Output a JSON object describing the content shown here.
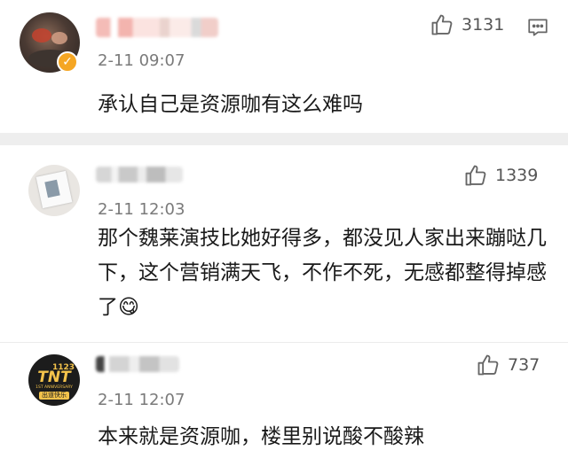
{
  "comments": [
    {
      "time": "2-11 09:07",
      "text": "承认自己是资源咖有这么难吗",
      "likes": "3131",
      "verified": true
    },
    {
      "time": "2-11 12:03",
      "text": "那个魏莱演技比她好得多，都没见人家出来蹦哒几下，这个营销满天飞，不作不死，无感都整得掉感了😋",
      "likes": "1339"
    },
    {
      "time": "2-11 12:07",
      "text": "本来就是资源咖，楼里别说酸不酸辣",
      "likes": "737",
      "avatar_text": {
        "number": "1123",
        "logo": "TNT",
        "sub": "1ST ANNIVERSARY",
        "bar": "出道快乐"
      }
    }
  ],
  "icons": {
    "like": "thumbs-up-icon",
    "reply": "comment-icon",
    "verified": "verified-badge-icon"
  },
  "colors": {
    "verified": "#f5a623",
    "divider": "#eeeeee",
    "meta_text": "#7a7a7a"
  }
}
